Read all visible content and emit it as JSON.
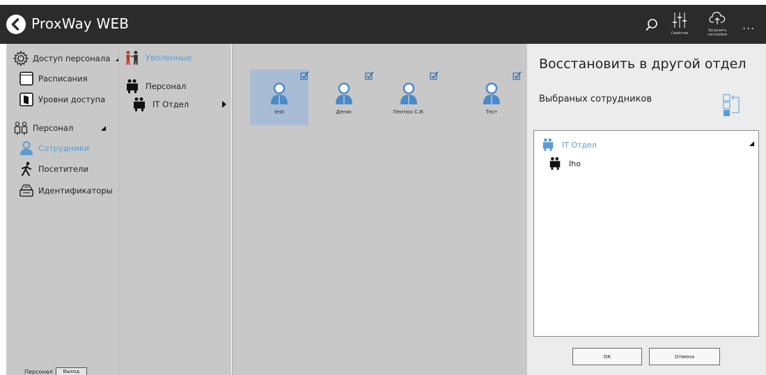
{
  "app": {
    "title": "ProxWay WEB"
  },
  "toolbar": {
    "search_icon": "search-icon",
    "properties_label": "Свойства",
    "upload_label": "Загрузить настройки",
    "more_label": "..."
  },
  "leftnav": {
    "items": [
      {
        "label": "Доступ персонала",
        "icon": "gear-icon"
      },
      {
        "label": "Расписания",
        "icon": "calendar-icon"
      },
      {
        "label": "Уровни доступа",
        "icon": "door-icon"
      },
      {
        "label": "Персонал",
        "icon": "personnel-icon"
      },
      {
        "label": "Сотрудники",
        "icon": "employee-icon"
      },
      {
        "label": "Посетители",
        "icon": "visitor-icon"
      },
      {
        "label": "Идентификаторы",
        "icon": "card-reader-icon"
      }
    ],
    "footer_label": "Персонал",
    "exit_label": "Выход"
  },
  "tree": {
    "fired_label": "Уволенные",
    "personnel_label": "Персонал",
    "department_label": "IT Отдел"
  },
  "employees": [
    {
      "name": "test",
      "selected": true
    },
    {
      "name": "Денис",
      "selected": false
    },
    {
      "name": "Пентюх С.И.",
      "selected": false
    },
    {
      "name": "Тест",
      "selected": false
    }
  ],
  "panel": {
    "title": "Восстановить в другой отдел",
    "subtitle": "Выбраных сотрудников",
    "group_label": "IT Отдел",
    "child_label": "Iho",
    "ok_label": "ОК",
    "cancel_label": "Отмена"
  },
  "colors": {
    "topbar": "#2b2b2b",
    "accent": "#5b9bd5",
    "selection": "#a9bcd6"
  }
}
